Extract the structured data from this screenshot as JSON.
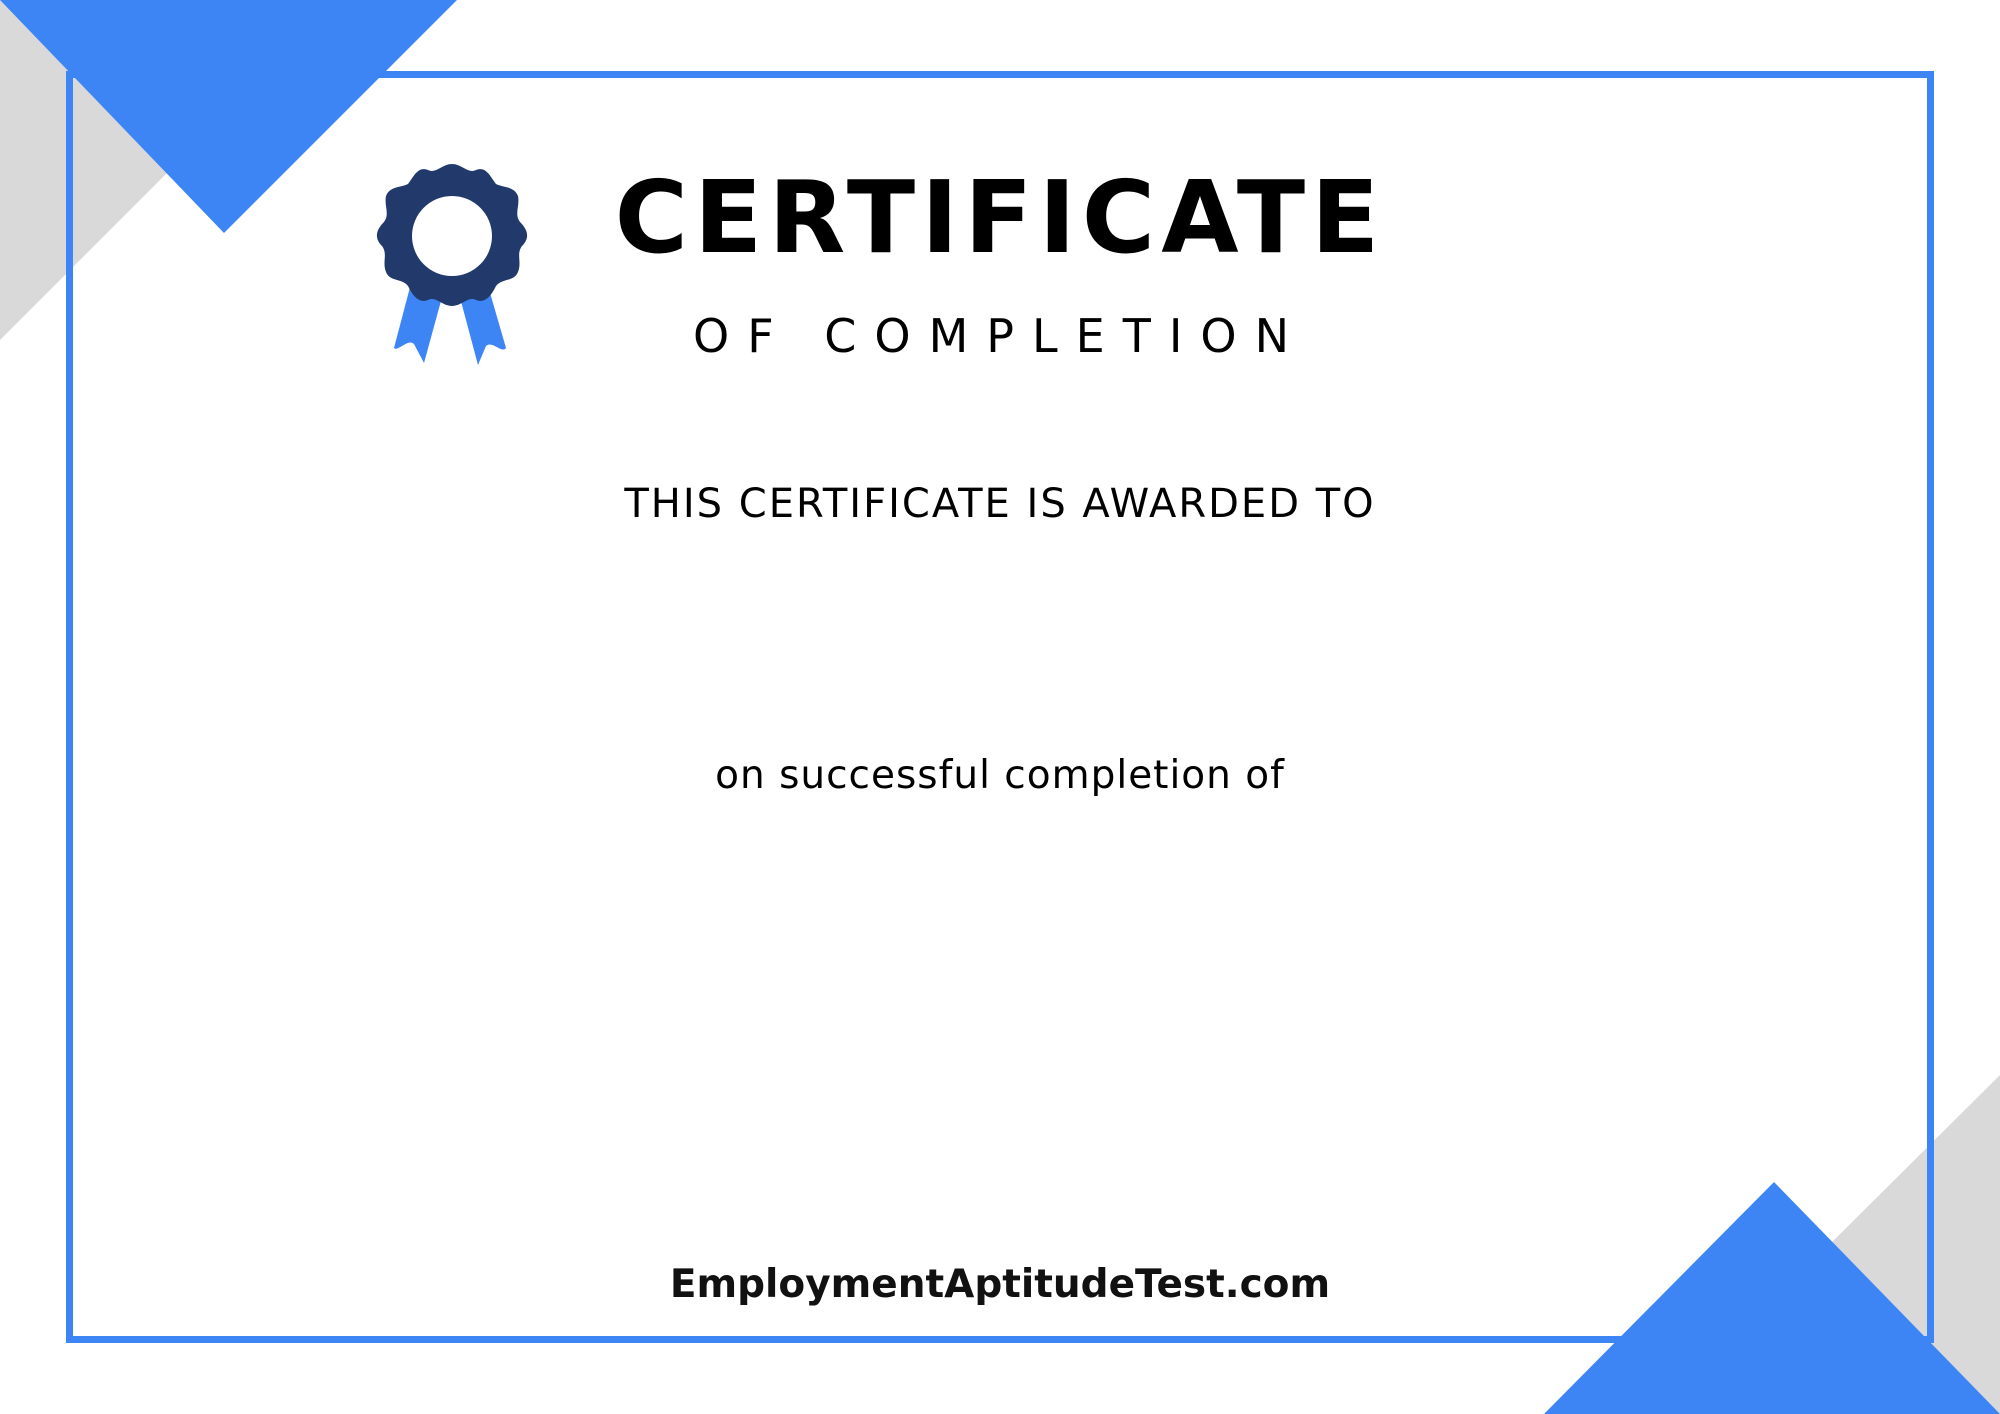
{
  "certificate": {
    "title": "CERTIFICATE",
    "subtitle": "OF COMPLETION",
    "awarded_text": "THIS CERTIFICATE IS AWARDED TO",
    "completion_text": "on successful completion of",
    "website": "EmploymentAptitudeTest.com"
  },
  "icons": {
    "badge": "award-rosette-icon"
  },
  "colors": {
    "accent_blue": "#3d85f5",
    "badge_navy": "#213a6b",
    "corner_gray": "#d9d9d9",
    "text": "#000000"
  }
}
